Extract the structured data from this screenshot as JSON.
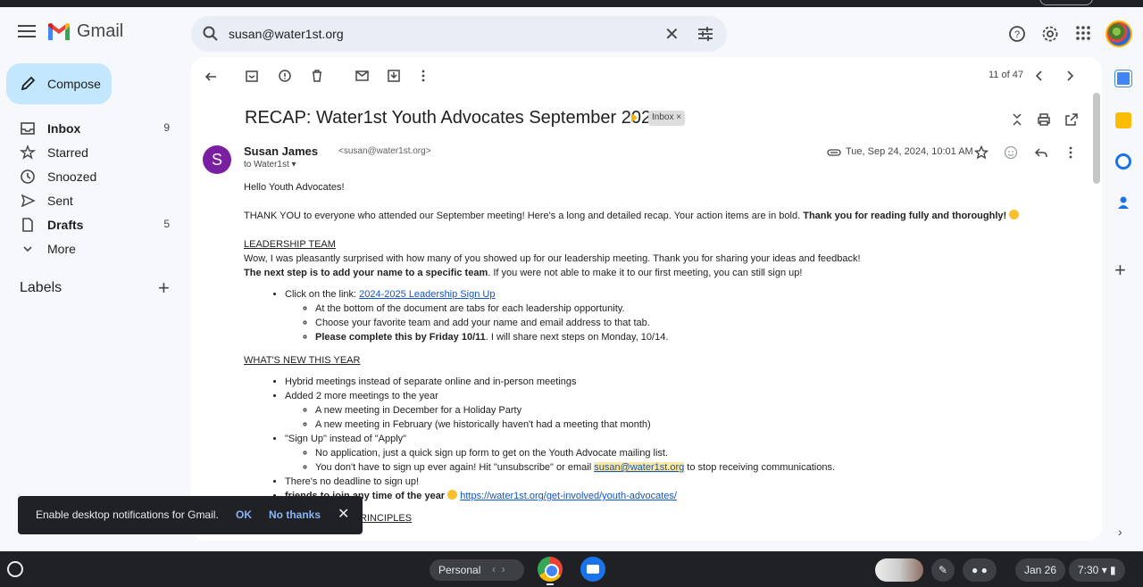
{
  "app": {
    "name": "Gmail"
  },
  "search": {
    "query": "susan@water1st.org"
  },
  "compose": {
    "label": "Compose"
  },
  "nav": [
    {
      "label": "Inbox",
      "count": "9",
      "bold": true
    },
    {
      "label": "Starred",
      "count": ""
    },
    {
      "label": "Snoozed",
      "count": ""
    },
    {
      "label": "Sent",
      "count": ""
    },
    {
      "label": "Drafts",
      "count": "5",
      "bold": true
    },
    {
      "label": "More",
      "count": ""
    }
  ],
  "labels": {
    "title": "Labels"
  },
  "toolbar": {
    "pager": "11 of 47"
  },
  "email": {
    "subject": "RECAP: Water1st Youth Advocates September 2024",
    "chip": "Inbox ×",
    "sender_initial": "S",
    "sender_name": "Susan James",
    "sender_email": "<susan@water1st.org>",
    "to": "to Water1st",
    "date": "Tue, Sep 24, 2024, 10:01 AM",
    "greeting": "Hello Youth Advocates!",
    "thanks_intro": "THANK YOU to everyone who attended our September meeting! Here's a long and detailed recap. Your action items are in bold. ",
    "thanks_bold": "Thank you for reading fully and thoroughly!",
    "leadership_heading": "LEADERSHIP TEAM",
    "leadership_p1": "Wow, I was pleasantly surprised with how many of you showed up for our leadership meeting. Thank you for sharing your ideas and feedback!",
    "leadership_p2_bold": "The next step is to add your name to a specific team",
    "leadership_p2_rest": ". If you were not able to make it to our first meeting, you can still sign up!",
    "click_text": "Click on the link: ",
    "click_link": "2024-2025 Leadership Sign Up",
    "sub1": "At the bottom of the document are tabs for each leadership opportunity.",
    "sub2": "Choose your favorite team and add your name and email address to that tab.",
    "sub3_bold": "Please complete this by Friday 10/11",
    "sub3_rest": ". I will share next steps on Monday, 10/14.",
    "new_heading": "WHAT'S NEW THIS YEAR ",
    "new1": "Hybrid meetings instead of separate online and in-person meetings",
    "new2": "Added 2 more meetings to the year",
    "new2a": "A new meeting in December for a Holiday Party",
    "new2b": "A new meeting in February (we historically haven't had a meeting that month)",
    "new3": "\"Sign Up\" instead of \"Apply\"",
    "new3a": "No application, just a quick sign up form to get on the Youth Advocate mailing list.",
    "new3b_pre": "You don't have to sign up ever again! Hit \"unsubscribe\" or email ",
    "new3b_link": "susan@water1st.org",
    "new3b_post": " to stop receiving communications.",
    "new4": "There's no deadline to sign up!",
    "new5_bold": "friends to join any time of the year",
    "new5_link": "https://water1st.org/get-involved/youth-advocates/",
    "principles_fragment": "RINCIPLES"
  },
  "snackbar": {
    "message": "Enable desktop notifications for Gmail.",
    "ok": "OK",
    "no": "No thanks"
  },
  "shelf": {
    "desk": "Personal",
    "date": "Jan 26",
    "time": "7:30"
  }
}
